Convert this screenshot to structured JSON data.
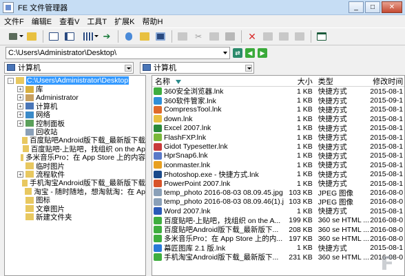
{
  "window": {
    "title": "FE 文件管理器"
  },
  "menu": [
    "文件F",
    "编辑E",
    "查看V",
    "工具T",
    "扩展K",
    "帮助H"
  ],
  "address": {
    "value": "C:\\Users\\Administrator\\Desktop\\"
  },
  "drives": {
    "left": "计算机",
    "right": "计算机"
  },
  "tree": [
    {
      "label": "C:\\Users\\Administrator\\Desktop",
      "indent": 0,
      "expander": "-",
      "selected": true,
      "icon": "folder-icon"
    },
    {
      "label": "库",
      "indent": 1,
      "expander": "+",
      "icon": "library-icon"
    },
    {
      "label": "Administrator",
      "indent": 1,
      "expander": "+",
      "icon": "user-folder-icon"
    },
    {
      "label": "计算机",
      "indent": 1,
      "expander": "+",
      "icon": "computer-icon"
    },
    {
      "label": "网络",
      "indent": 1,
      "expander": "+",
      "icon": "network-icon"
    },
    {
      "label": "控制面板",
      "indent": 1,
      "expander": "+",
      "icon": "control-panel-icon"
    },
    {
      "label": "回收站",
      "indent": 1,
      "expander": "",
      "icon": "recycle-bin-icon"
    },
    {
      "label": "百度贴吧Android版下载_最新版下载",
      "indent": 1,
      "expander": "",
      "icon": "folder-icon"
    },
    {
      "label": "百度贴吧-上贴吧，找组织  on the Ap",
      "indent": 1,
      "expander": "",
      "icon": "folder-icon"
    },
    {
      "label": "多米音乐Pro：在 App Store 上的内容",
      "indent": 1,
      "expander": "",
      "icon": "folder-icon"
    },
    {
      "label": "临时图片",
      "indent": 1,
      "expander": "",
      "icon": "folder-icon"
    },
    {
      "label": "流程软件",
      "indent": 1,
      "expander": "+",
      "icon": "folder-icon"
    },
    {
      "label": "手机淘宝Android版下载_最新版下载",
      "indent": 1,
      "expander": "",
      "icon": "folder-icon"
    },
    {
      "label": "淘宝 - 随时随地，想淘就淘：在 Ap",
      "indent": 1,
      "expander": "",
      "icon": "folder-icon"
    },
    {
      "label": "图标",
      "indent": 1,
      "expander": "",
      "icon": "folder-icon"
    },
    {
      "label": "文章图片",
      "indent": 1,
      "expander": "",
      "icon": "folder-icon"
    },
    {
      "label": "新建文件夹",
      "indent": 1,
      "expander": "",
      "icon": "folder-icon"
    }
  ],
  "columns": {
    "name": "名称",
    "size": "大小",
    "type": "类型",
    "date": "修改时间"
  },
  "files": [
    {
      "name": "360安全浏览器.lnk",
      "size": "1 KB",
      "type": "快捷方式",
      "date": "2015-08-1",
      "color": "#3fae3f"
    },
    {
      "name": "360软件管家.lnk",
      "size": "1 KB",
      "type": "快捷方式",
      "date": "2015-09-1",
      "color": "#2f8fd8"
    },
    {
      "name": "CompressTool.lnk",
      "size": "1 KB",
      "type": "快捷方式",
      "date": "2015-08-1",
      "color": "#e06a2a"
    },
    {
      "name": "down.lnk",
      "size": "1 KB",
      "type": "快捷方式",
      "date": "2015-08-1",
      "color": "#e8c040"
    },
    {
      "name": "Excel 2007.lnk",
      "size": "1 KB",
      "type": "快捷方式",
      "date": "2015-08-1",
      "color": "#2a8a3a"
    },
    {
      "name": "FlashFXP.lnk",
      "size": "1 KB",
      "type": "快捷方式",
      "date": "2015-08-1",
      "color": "#7ab83a"
    },
    {
      "name": "Gidot Typesetter.lnk",
      "size": "1 KB",
      "type": "快捷方式",
      "date": "2015-08-1",
      "color": "#c83a3a"
    },
    {
      "name": "HprSnap6.lnk",
      "size": "1 KB",
      "type": "快捷方式",
      "date": "2015-08-1",
      "color": "#5a7ac8"
    },
    {
      "name": "iconmaster.lnk",
      "size": "1 KB",
      "type": "快捷方式",
      "date": "2015-08-1",
      "color": "#e8a020"
    },
    {
      "name": "Photoshop.exe - 快捷方式.lnk",
      "size": "1 KB",
      "type": "快捷方式",
      "date": "2015-08-1",
      "color": "#1a4a8a"
    },
    {
      "name": "PowerPoint 2007.lnk",
      "size": "1 KB",
      "type": "快捷方式",
      "date": "2015-08-1",
      "color": "#d8542a"
    },
    {
      "name": "temp_photo 2016-08-03 08.09.45.jpg",
      "size": "103 KB",
      "type": "JPEG 图像",
      "date": "2016-08-0",
      "color": "#8aa0b8"
    },
    {
      "name": "temp_photo 2016-08-03 08.09.46(1).jpg",
      "size": "103 KB",
      "type": "JPEG 图像",
      "date": "2016-08-0",
      "color": "#8aa0b8"
    },
    {
      "name": "Word 2007.lnk",
      "size": "1 KB",
      "type": "快捷方式",
      "date": "2015-08-1",
      "color": "#2a5ab8"
    },
    {
      "name": "百度贴吧-上贴吧，找组织  on the A...",
      "size": "199 KB",
      "type": "360 se HTML ...",
      "date": "2016-08-0",
      "color": "#3fae3f"
    },
    {
      "name": "百度贴吧Android版下载_最新版下...",
      "size": "208 KB",
      "type": "360 se HTML ...",
      "date": "2016-08-0",
      "color": "#3fae3f"
    },
    {
      "name": "多米音乐Pro：在 App Store 上的内...",
      "size": "197 KB",
      "type": "360 se HTML ...",
      "date": "2016-08-0",
      "color": "#3fae3f"
    },
    {
      "name": "幕匠图库 2.1 版.lnk",
      "size": "1 KB",
      "type": "快捷方式",
      "date": "2015-08-1",
      "color": "#2a7ad8"
    },
    {
      "name": "手机淘宝Android版下载_最新版下...",
      "size": "231 KB",
      "type": "360 se HTML ...",
      "date": "2016-08-0",
      "color": "#3fae3f"
    }
  ],
  "toolbar_icons": [
    "view-mode-icon",
    "up-folder-icon",
    "panel-icon",
    "columns-icon",
    "grid-icon",
    "go-arrow-icon",
    "properties-icon",
    "new-folder-icon",
    "window-icon",
    "copy-icon",
    "cut-icon",
    "paste-icon",
    "duplicate-icon",
    "delete-icon",
    "rename-icon",
    "settings-icon",
    "edit-icon",
    "layout-icon"
  ]
}
